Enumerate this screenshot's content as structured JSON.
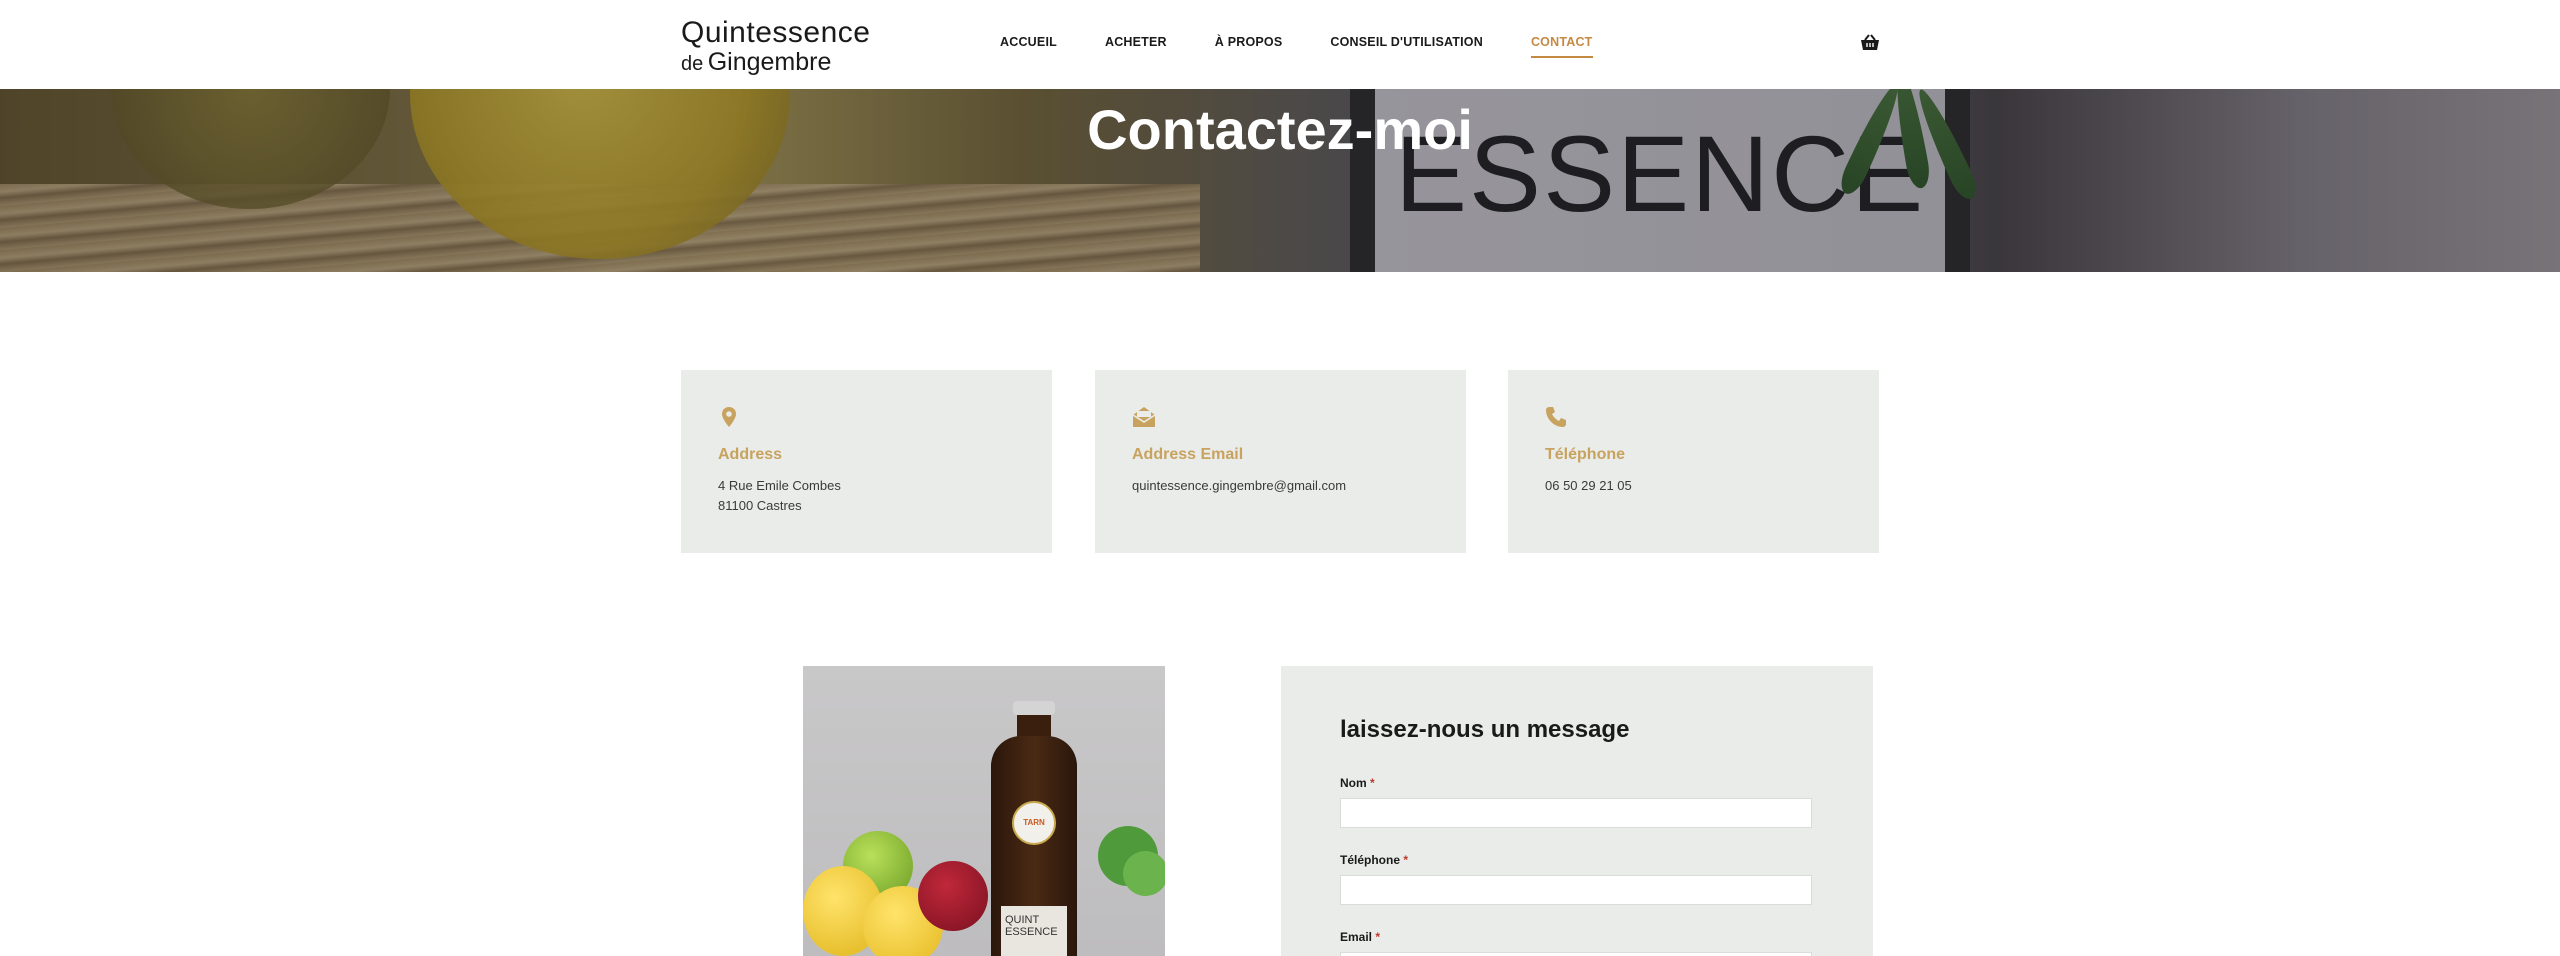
{
  "header": {
    "logo": {
      "line1": "Quintessence",
      "de": "de",
      "gingembre": "Gingembre"
    },
    "nav": [
      {
        "label": "ACCUEIL"
      },
      {
        "label": "ACHETER"
      },
      {
        "label": "À PROPOS"
      },
      {
        "label": "CONSEIL D'UTILISATION"
      },
      {
        "label": "CONTACT",
        "active": true
      }
    ],
    "cart_icon": "basket-icon"
  },
  "hero": {
    "title": "Contactez-moi",
    "background_text": "ESSENCE"
  },
  "cards": [
    {
      "icon": "map-pin-icon",
      "title": "Address",
      "lines": [
        "4 Rue Emile Combes",
        "81100 Castres"
      ]
    },
    {
      "icon": "envelope-open-icon",
      "title": "Address Email",
      "lines": [
        "quintessence.gingembre@gmail.com"
      ]
    },
    {
      "icon": "phone-icon",
      "title": "Téléphone",
      "lines": [
        "06 50 29 21 05"
      ]
    }
  ],
  "photo": {
    "badge_text": "TARN",
    "label_text": "QUINT ESSENCE"
  },
  "form": {
    "title": "laissez-nous un message",
    "fields": [
      {
        "label": "Nom",
        "required_mark": "*",
        "value": ""
      },
      {
        "label": "Téléphone",
        "required_mark": "*",
        "value": ""
      },
      {
        "label": "Email",
        "required_mark": "*",
        "value": ""
      }
    ]
  },
  "colors": {
    "accent": "#c58a42",
    "card_title": "#c8a25f",
    "card_bg": "#e9ece8"
  }
}
